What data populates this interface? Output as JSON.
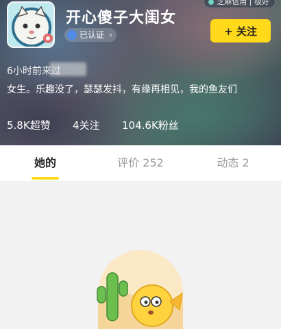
{
  "top_badge": "芝麻信用 | 极好",
  "profile": {
    "nickname": "开心傻子大闺女",
    "verified_label": "已认证",
    "follow_label": "+ 关注",
    "time": "6小时前来过",
    "bio": "女生。乐趣没了，瑟瑟发抖，有缘再相见，我的鱼友们"
  },
  "stats": {
    "likes": "5.8K超赞",
    "following": "4关注",
    "followers": "104.6K粉丝"
  },
  "tabs": [
    {
      "label": "她的"
    },
    {
      "label": "评价 252"
    },
    {
      "label": "动态 2"
    }
  ],
  "colors": {
    "accent": "#ffd91a",
    "page_bg": "#f2f2f2"
  },
  "icons": {
    "avatar": "avatar-cat",
    "verified": "verified-icon",
    "empty_state": "cactus-fish-illustration"
  }
}
